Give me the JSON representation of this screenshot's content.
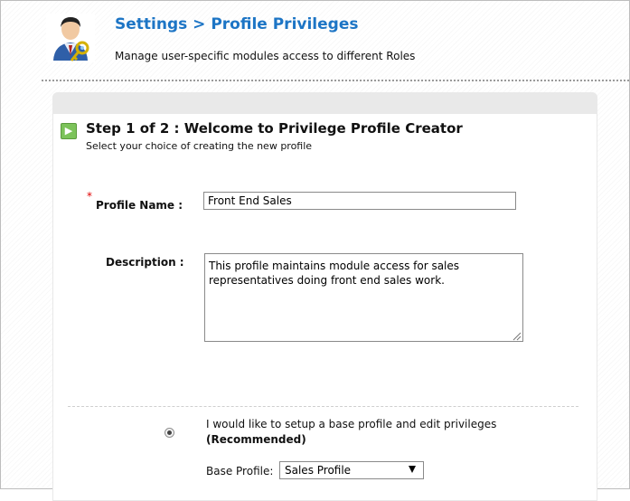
{
  "header": {
    "title": "Settings > Profile Privileges",
    "subtitle": "Manage user-specific modules access to different Roles",
    "icon": "user-key-icon"
  },
  "step": {
    "title": "Step 1 of 2 : Welcome to Privilege Profile Creator",
    "subtitle": "Select your choice of creating the new profile"
  },
  "form": {
    "required_marker": "*",
    "profile_name_label": "Profile Name :",
    "profile_name_value": "Front End Sales",
    "description_label": "Description :",
    "description_value": "This profile maintains module access for sales representatives doing front end sales work."
  },
  "base_option": {
    "text": "I would like to setup a base profile and edit privileges",
    "recommended": "(Recommended)",
    "selected": true,
    "base_profile_label": "Base Profile:",
    "base_profile_value": "Sales Profile"
  },
  "colors": {
    "title": "#1d75c5",
    "step_icon": "#7cc35a",
    "required": "#e00000"
  }
}
